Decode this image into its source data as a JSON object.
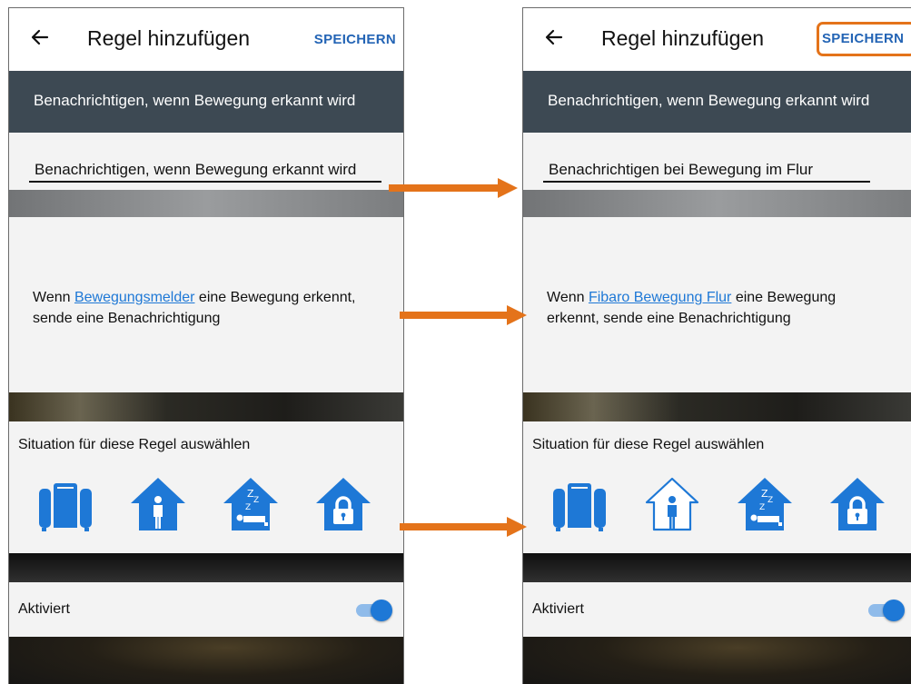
{
  "left_screen": {
    "header": {
      "title": "Regel hinzufügen",
      "save_label": "SPEICHERN"
    },
    "summary_banner": "Benachrichtigen, wenn Bewegung erkannt wird",
    "rule_name_value": "Benachrichtigen, wenn Bewegung erkannt wird",
    "description": {
      "prefix": "Wenn ",
      "link": "Bewegungsmelder",
      "suffix": " eine Bewegung erkennt, sende eine Benachrichtigung"
    },
    "situation_label": "Situation für diese Regel auswählen",
    "situations": [
      {
        "icon": "suitcase-icon",
        "selected": true
      },
      {
        "icon": "house-person-icon",
        "selected": true
      },
      {
        "icon": "house-sleep-icon",
        "selected": true
      },
      {
        "icon": "house-lock-icon",
        "selected": true
      }
    ],
    "activated_label": "Aktiviert",
    "activated": true
  },
  "right_screen": {
    "header": {
      "title": "Regel hinzufügen",
      "save_label": "SPEICHERN"
    },
    "summary_banner": "Benachrichtigen, wenn Bewegung erkannt wird",
    "rule_name_value": "Benachrichtigen bei Bewegung im Flur",
    "description": {
      "prefix": "Wenn ",
      "link": "Fibaro Bewegung Flur",
      "suffix": " eine Bewegung erkennt, sende eine Benachrichtigung"
    },
    "situation_label": "Situation für diese Regel auswählen",
    "situations": [
      {
        "icon": "suitcase-icon",
        "selected": true
      },
      {
        "icon": "house-person-icon",
        "selected": false
      },
      {
        "icon": "house-sleep-icon",
        "selected": true
      },
      {
        "icon": "house-lock-icon",
        "selected": true
      }
    ],
    "activated_label": "Aktiviert",
    "activated": true
  },
  "colors": {
    "accent_blue": "#1e78d6",
    "save_text_blue": "#2364b5",
    "highlight_orange": "#e4731a",
    "arrow_orange": "#e4731a",
    "banner_dark": "#3d4953"
  }
}
